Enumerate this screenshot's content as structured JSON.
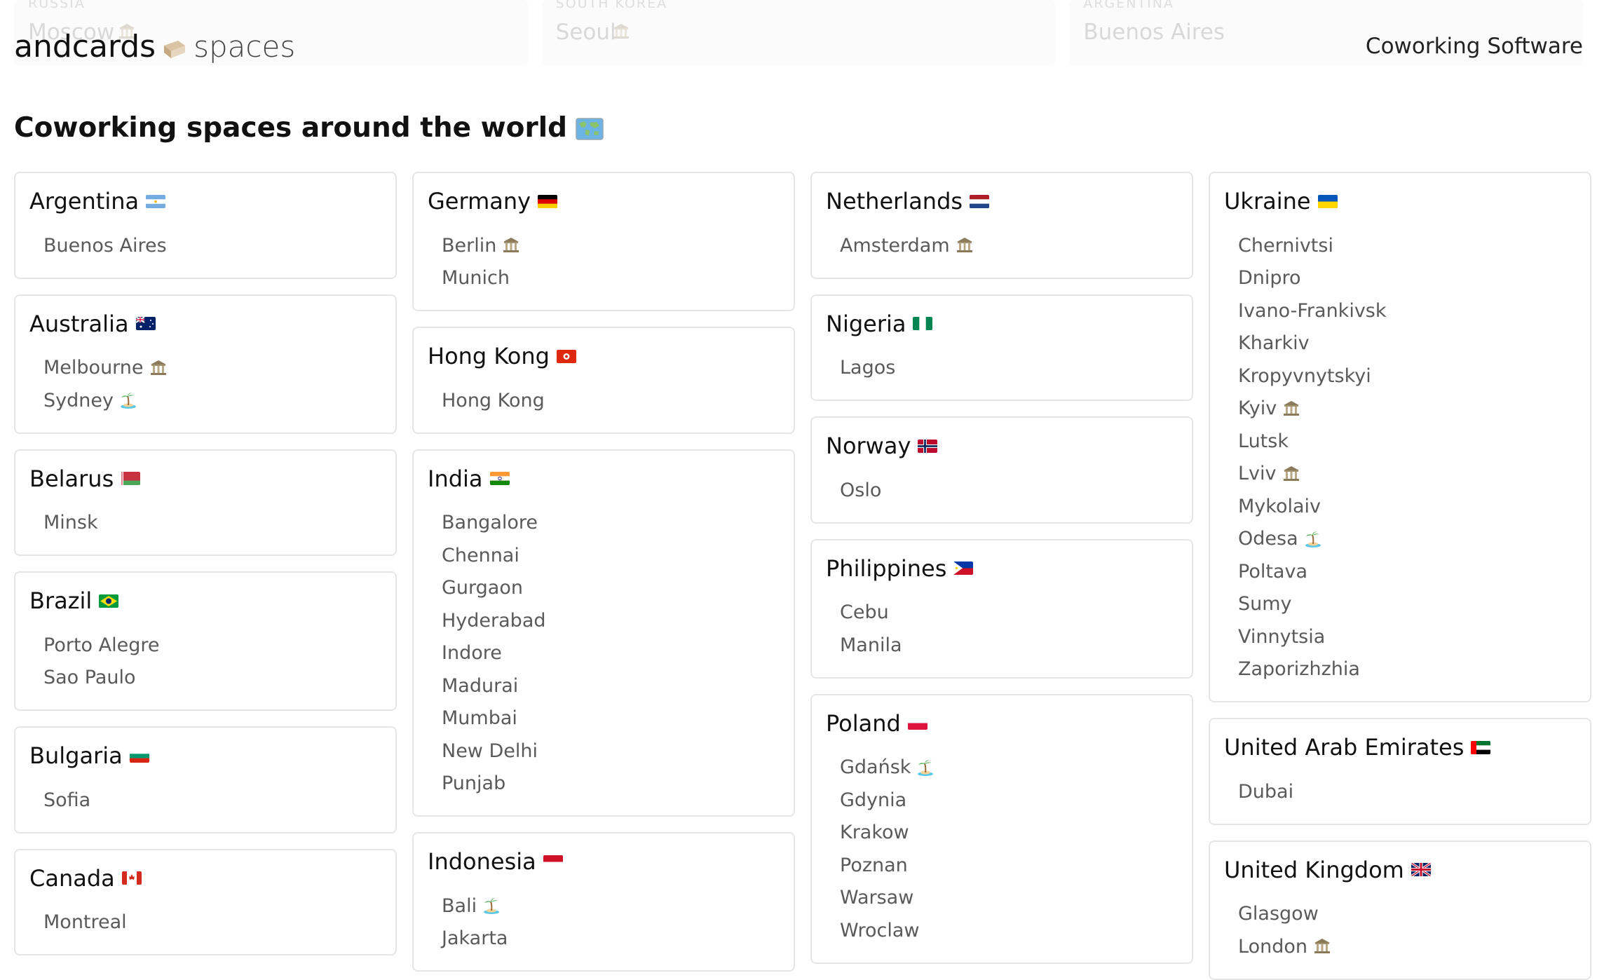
{
  "top_strip": [
    {
      "country": "RUSSIA",
      "city": "Moscow"
    },
    {
      "country": "SOUTH KOREA",
      "city": "Seoul"
    },
    {
      "country": "ARGENTINA",
      "city": "Buenos Aires"
    }
  ],
  "header": {
    "logo_andcards": "andcards",
    "logo_spaces": "spaces",
    "nav_link": "Coworking Software"
  },
  "section_title": "Coworking spaces around the world",
  "columns": [
    [
      {
        "name": "Argentina",
        "flag": "ar",
        "cities": [
          {
            "name": "Buenos Aires",
            "icon": ""
          }
        ]
      },
      {
        "name": "Australia",
        "flag": "au",
        "cities": [
          {
            "name": "Melbourne",
            "icon": "museum"
          },
          {
            "name": "Sydney",
            "icon": "island"
          }
        ]
      },
      {
        "name": "Belarus",
        "flag": "by",
        "cities": [
          {
            "name": "Minsk",
            "icon": ""
          }
        ]
      },
      {
        "name": "Brazil",
        "flag": "br",
        "cities": [
          {
            "name": "Porto Alegre",
            "icon": ""
          },
          {
            "name": "Sao Paulo",
            "icon": ""
          }
        ]
      },
      {
        "name": "Bulgaria",
        "flag": "bg",
        "cities": [
          {
            "name": "Sofia",
            "icon": ""
          }
        ]
      },
      {
        "name": "Canada",
        "flag": "ca",
        "cities": [
          {
            "name": "Montreal",
            "icon": ""
          }
        ]
      }
    ],
    [
      {
        "name": "Germany",
        "flag": "de",
        "cities": [
          {
            "name": "Berlin",
            "icon": "museum"
          },
          {
            "name": "Munich",
            "icon": ""
          }
        ]
      },
      {
        "name": "Hong Kong",
        "flag": "hk",
        "cities": [
          {
            "name": "Hong Kong",
            "icon": ""
          }
        ]
      },
      {
        "name": "India",
        "flag": "in",
        "cities": [
          {
            "name": "Bangalore",
            "icon": ""
          },
          {
            "name": "Chennai",
            "icon": ""
          },
          {
            "name": "Gurgaon",
            "icon": ""
          },
          {
            "name": "Hyderabad",
            "icon": ""
          },
          {
            "name": "Indore",
            "icon": ""
          },
          {
            "name": "Madurai",
            "icon": ""
          },
          {
            "name": "Mumbai",
            "icon": ""
          },
          {
            "name": "New Delhi",
            "icon": ""
          },
          {
            "name": "Punjab",
            "icon": ""
          }
        ]
      },
      {
        "name": "Indonesia",
        "flag": "id",
        "cities": [
          {
            "name": "Bali",
            "icon": "island"
          },
          {
            "name": "Jakarta",
            "icon": ""
          }
        ]
      }
    ],
    [
      {
        "name": "Netherlands",
        "flag": "nl",
        "cities": [
          {
            "name": "Amsterdam",
            "icon": "museum"
          }
        ]
      },
      {
        "name": "Nigeria",
        "flag": "ng",
        "cities": [
          {
            "name": "Lagos",
            "icon": ""
          }
        ]
      },
      {
        "name": "Norway",
        "flag": "no",
        "cities": [
          {
            "name": "Oslo",
            "icon": ""
          }
        ]
      },
      {
        "name": "Philippines",
        "flag": "ph",
        "cities": [
          {
            "name": "Cebu",
            "icon": ""
          },
          {
            "name": "Manila",
            "icon": ""
          }
        ]
      },
      {
        "name": "Poland",
        "flag": "pl",
        "cities": [
          {
            "name": "Gdańsk",
            "icon": "island"
          },
          {
            "name": "Gdynia",
            "icon": ""
          },
          {
            "name": "Krakow",
            "icon": ""
          },
          {
            "name": "Poznan",
            "icon": ""
          },
          {
            "name": "Warsaw",
            "icon": ""
          },
          {
            "name": "Wroclaw",
            "icon": ""
          }
        ]
      }
    ],
    [
      {
        "name": "Ukraine",
        "flag": "ua",
        "cities": [
          {
            "name": "Chernivtsi",
            "icon": ""
          },
          {
            "name": "Dnipro",
            "icon": ""
          },
          {
            "name": "Ivano-Frankivsk",
            "icon": ""
          },
          {
            "name": "Kharkiv",
            "icon": ""
          },
          {
            "name": "Kropyvnytskyi",
            "icon": ""
          },
          {
            "name": "Kyiv",
            "icon": "museum"
          },
          {
            "name": "Lutsk",
            "icon": ""
          },
          {
            "name": "Lviv",
            "icon": "museum"
          },
          {
            "name": "Mykolaiv",
            "icon": ""
          },
          {
            "name": "Odesa",
            "icon": "island"
          },
          {
            "name": "Poltava",
            "icon": ""
          },
          {
            "name": "Sumy",
            "icon": ""
          },
          {
            "name": "Vinnytsia",
            "icon": ""
          },
          {
            "name": "Zaporizhzhia",
            "icon": ""
          }
        ]
      },
      {
        "name": "United Arab Emirates",
        "flag": "ae",
        "cities": [
          {
            "name": "Dubai",
            "icon": ""
          }
        ]
      },
      {
        "name": "United Kingdom",
        "flag": "gb",
        "cities": [
          {
            "name": "Glasgow",
            "icon": ""
          },
          {
            "name": "London",
            "icon": "museum"
          }
        ]
      }
    ]
  ]
}
